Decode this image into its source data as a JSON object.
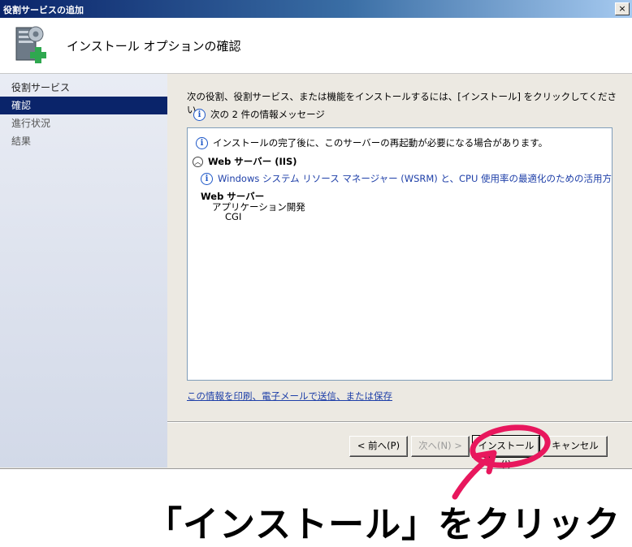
{
  "window": {
    "title": "役割サービスの追加",
    "close_label": "×"
  },
  "header": {
    "title": "インストール オプションの確認",
    "icon": "server-add-icon"
  },
  "sidebar": {
    "items": [
      {
        "label": "役割サービス"
      },
      {
        "label": "確認",
        "active": true
      },
      {
        "label": "進行状況"
      },
      {
        "label": "結果"
      }
    ]
  },
  "content": {
    "intro": "次の役割、役割サービス、または機能をインストールするには、[インストール] をクリックしてください。",
    "message_count": "次の 2 件の情報メッセージ",
    "infobox": {
      "restart_note": "インストールの完了後に、このサーバーの再起動が必要になる場合があります。",
      "section_title": "Web サーバー (IIS)",
      "wsrm_note": "Windows システム リソース マネージャー (WSRM) と、CPU 使用率の最適化のための活用方法の詳細",
      "tree": {
        "root": "Web サーバー",
        "child": "アプリケーション開発",
        "leaf": "CGI"
      }
    },
    "link": "この情報を印刷、電子メールで送信、または保存"
  },
  "buttons": {
    "back": "< 前へ(P)",
    "next": "次へ(N) >",
    "install": "インストール(I)",
    "cancel": "キャンセル"
  },
  "annotation": {
    "caption": "「インストール」をクリック",
    "color": "#e8175d"
  }
}
